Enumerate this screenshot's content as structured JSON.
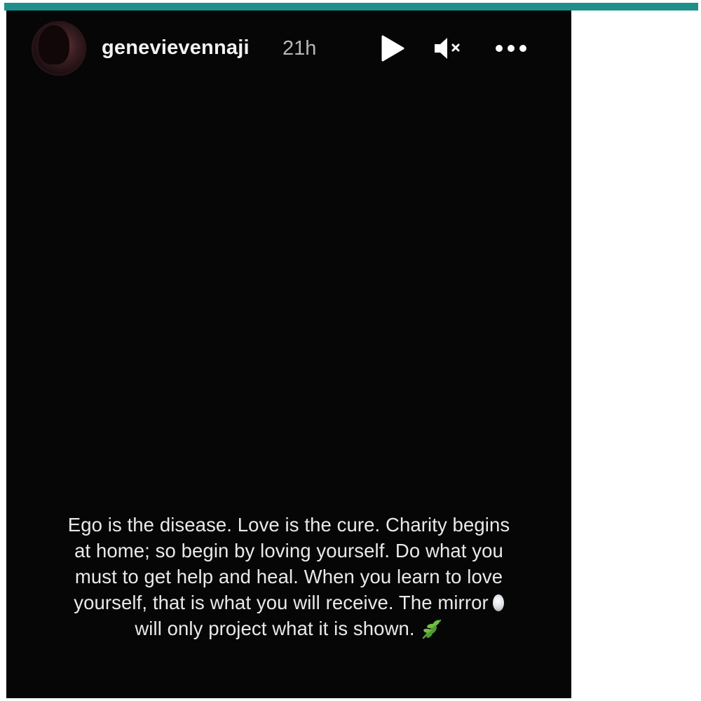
{
  "story": {
    "username": "genevievennaji",
    "timestamp": "21h",
    "controls": {
      "play_icon": "play-icon",
      "mute_icon": "speaker-muted-icon",
      "more_icon": "more-horizontal-icon"
    },
    "caption_lines": [
      "Ego is the disease. Love is the cure. Charity begins",
      "at home; so begin by loving yourself. Do what you",
      "must to get help and heal. When you learn to love",
      "yourself, that is what you will receive. The mirror",
      "will only project what it is shown."
    ],
    "emojis": {
      "mirror": "mirror-emoji",
      "leaf": "herb-emoji"
    }
  },
  "colors": {
    "accent_bar": "#1f8f8c",
    "story_background": "#060606",
    "text": "#e9e9e9"
  }
}
